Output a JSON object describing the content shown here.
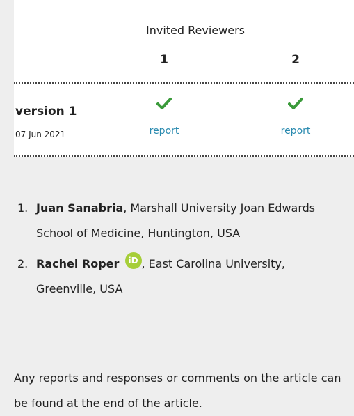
{
  "invited_reviewers": {
    "title": "Invited Reviewers",
    "columns": [
      "1",
      "2"
    ]
  },
  "versions": [
    {
      "label": "version 1",
      "date": "07 Jun 2021",
      "reports": [
        {
          "status": "approved",
          "icon": "checkmark-icon",
          "link_label": "report"
        },
        {
          "status": "approved",
          "icon": "checkmark-icon",
          "link_label": "report"
        }
      ]
    }
  ],
  "reviewers": [
    {
      "number": "1.",
      "name": "Juan Sanabria",
      "affiliation": ", Marshall University Joan Edwards School of Medicine, Huntington, USA",
      "orcid": false
    },
    {
      "number": "2.",
      "name": "Rachel Roper",
      "affiliation": ", East Carolina University, Greenville, USA",
      "orcid": true,
      "orcid_label": "iD"
    }
  ],
  "footer_note": "Any reports and responses or comments on the article can be found at the end of the article.",
  "colors": {
    "check": "#3a9a3a",
    "link": "#2b8bb0",
    "orcid": "#a6ce39"
  }
}
